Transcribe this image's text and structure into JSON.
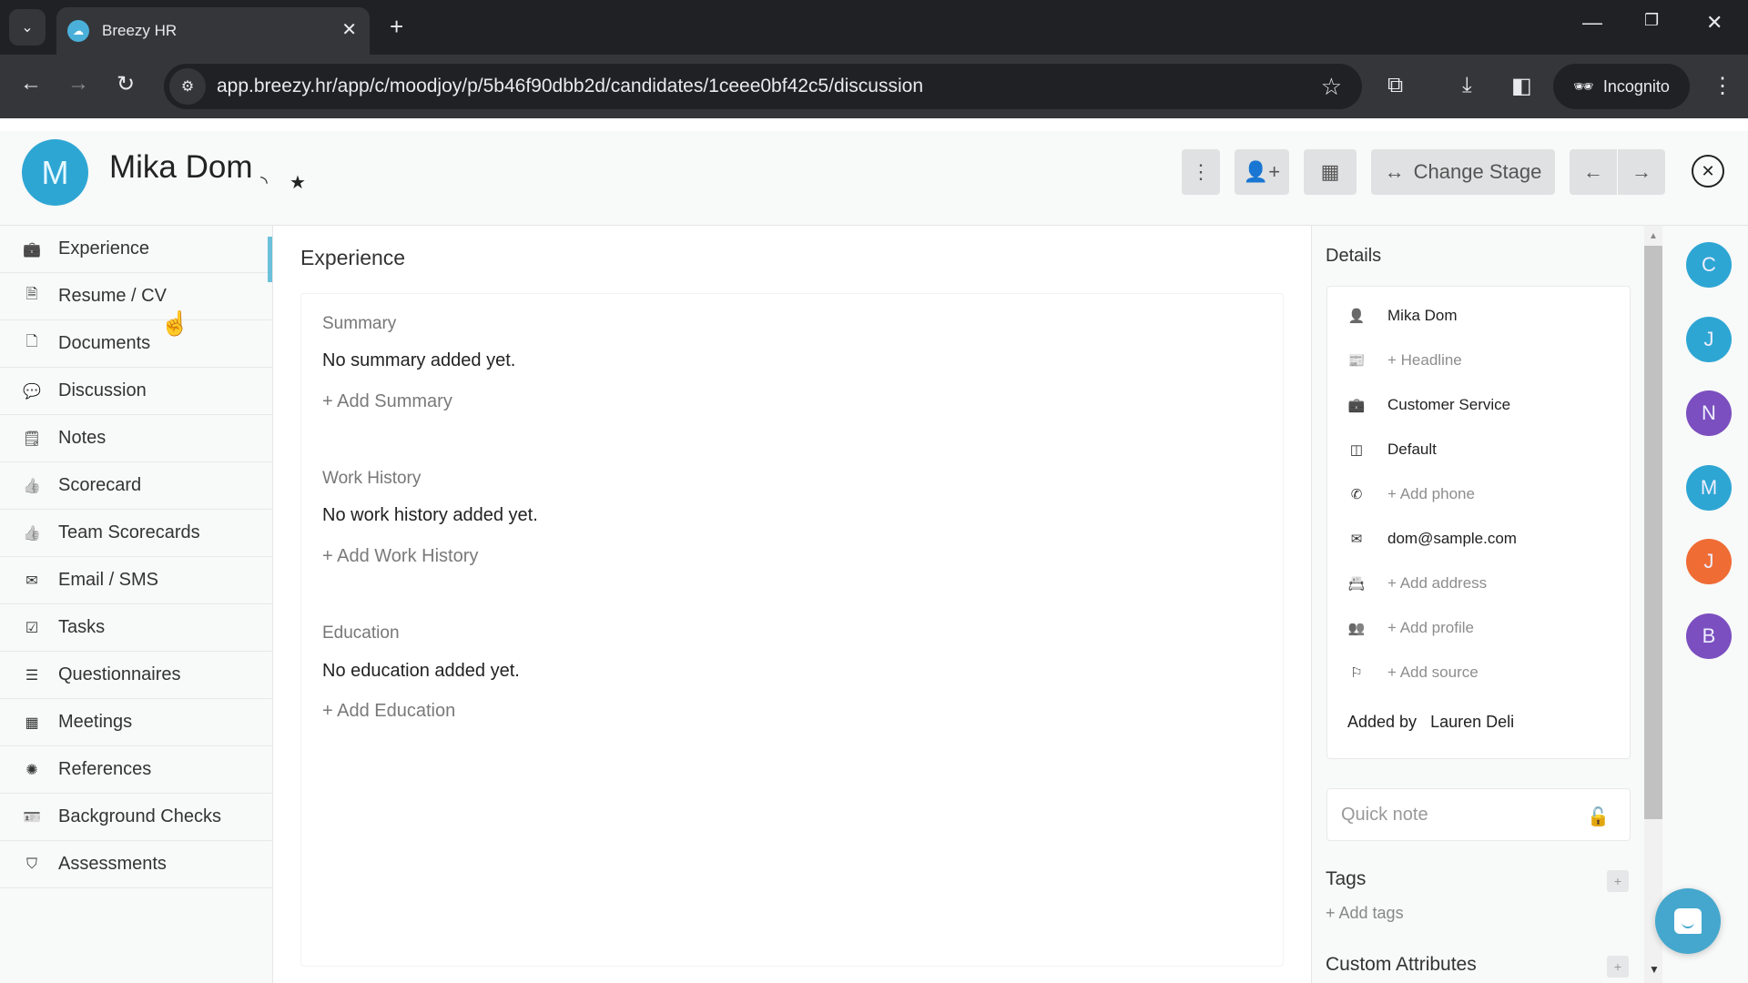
{
  "browser": {
    "tab_title": "Breezy HR",
    "url": "app.breezy.hr/app/c/moodjoy/p/5b46f90dbb2d/candidates/1ceee0bf42c5/discussion",
    "incognito_label": "Incognito"
  },
  "header": {
    "avatar_initial": "M",
    "candidate_name": "Mika Dom",
    "change_stage_label": "Change Stage"
  },
  "sidebar": {
    "items": [
      {
        "label": "Experience",
        "icon": "briefcase-icon",
        "active": true
      },
      {
        "label": "Resume / CV",
        "icon": "file-text-icon"
      },
      {
        "label": "Documents",
        "icon": "file-icon"
      },
      {
        "label": "Discussion",
        "icon": "comments-icon"
      },
      {
        "label": "Notes",
        "icon": "sticky-note-icon"
      },
      {
        "label": "Scorecard",
        "icon": "thumbs-up-icon"
      },
      {
        "label": "Team Scorecards",
        "icon": "thumbs-up-icon"
      },
      {
        "label": "Email / SMS",
        "icon": "envelope-icon"
      },
      {
        "label": "Tasks",
        "icon": "check-square-icon"
      },
      {
        "label": "Questionnaires",
        "icon": "list-icon"
      },
      {
        "label": "Meetings",
        "icon": "calendar-icon"
      },
      {
        "label": "References",
        "icon": "badge-icon"
      },
      {
        "label": "Background Checks",
        "icon": "id-card-icon"
      },
      {
        "label": "Assessments",
        "icon": "shield-check-icon"
      }
    ]
  },
  "main": {
    "title": "Experience",
    "sections": [
      {
        "label": "Summary",
        "empty": "No summary added yet.",
        "add": "+ Add Summary"
      },
      {
        "label": "Work History",
        "empty": "No work history added yet.",
        "add": "+ Add Work History"
      },
      {
        "label": "Education",
        "empty": "No education added yet.",
        "add": "+ Add Education"
      }
    ]
  },
  "details": {
    "title": "Details",
    "rows": [
      {
        "icon": "user-icon",
        "text": "Mika Dom",
        "placeholder": false
      },
      {
        "icon": "newspaper-icon",
        "text": "+ Headline",
        "placeholder": true
      },
      {
        "icon": "briefcase-icon",
        "text": "Customer Service",
        "placeholder": false
      },
      {
        "icon": "columns-icon",
        "text": "Default",
        "placeholder": false
      },
      {
        "icon": "phone-icon",
        "text": "+ Add phone",
        "placeholder": true
      },
      {
        "icon": "envelope-icon",
        "text": "dom@sample.com",
        "placeholder": false
      },
      {
        "icon": "address-card-icon",
        "text": "+ Add address",
        "placeholder": true
      },
      {
        "icon": "users-icon",
        "text": "+ Add profile",
        "placeholder": true
      },
      {
        "icon": "flag-icon",
        "text": "+ Add source",
        "placeholder": true
      }
    ],
    "added_by_label": "Added by",
    "added_by_name": "Lauren Deli",
    "quick_note_placeholder": "Quick note",
    "tags_title": "Tags",
    "add_tags": "+ Add tags",
    "custom_attributes_title": "Custom Attributes"
  },
  "rail": {
    "avatars": [
      {
        "initial": "C",
        "color": "#2ea6d4"
      },
      {
        "initial": "J",
        "color": "#2ea6d4"
      },
      {
        "initial": "N",
        "color": "#7b4fbf"
      },
      {
        "initial": "M",
        "color": "#2ea6d4"
      },
      {
        "initial": "J",
        "color": "#ef6c35"
      },
      {
        "initial": "B",
        "color": "#7b4fbf"
      }
    ]
  }
}
